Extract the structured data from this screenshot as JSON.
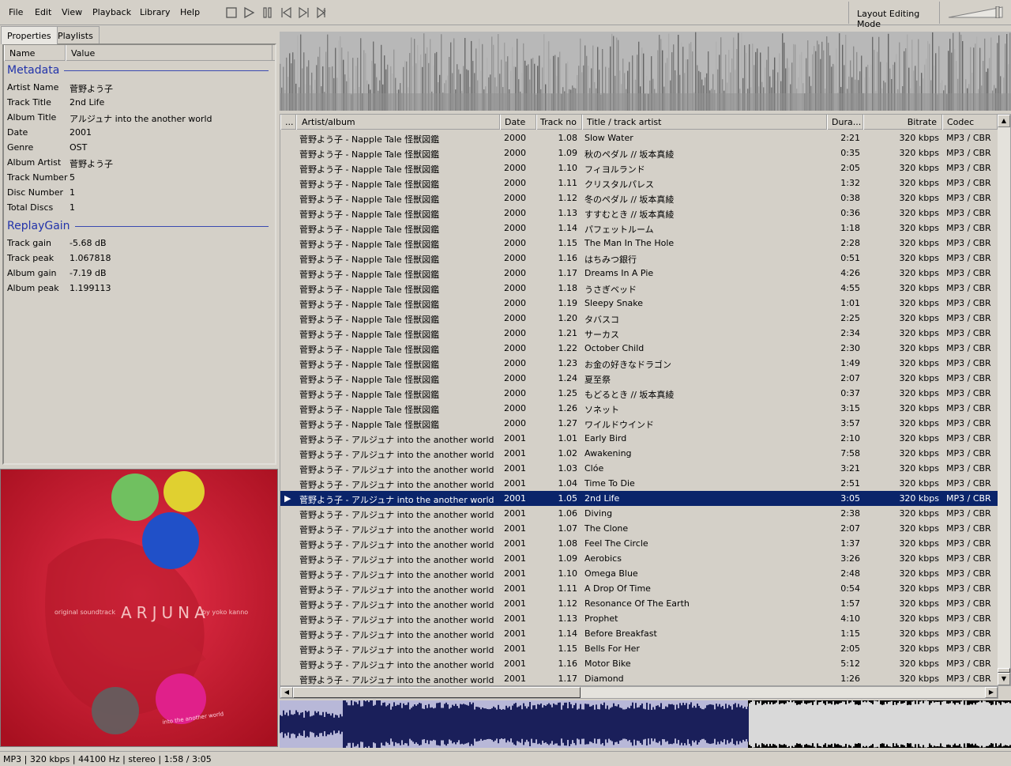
{
  "menu": {
    "file": "File",
    "edit": "Edit",
    "view": "View",
    "playback": "Playback",
    "library": "Library",
    "help": "Help"
  },
  "toolbar": {
    "layout_mode": "Layout Editing Mode",
    "volume_level": 0.92
  },
  "tabs": {
    "properties": "Properties",
    "playlists": "Playlists"
  },
  "properties": {
    "col_name": "Name",
    "col_value": "Value",
    "metadata_title": "Metadata",
    "metadata": [
      {
        "name": "Artist Name",
        "value": "菅野よう子"
      },
      {
        "name": "Track Title",
        "value": "2nd Life"
      },
      {
        "name": "Album Title",
        "value": "アルジュナ into the another world"
      },
      {
        "name": "Date",
        "value": "2001"
      },
      {
        "name": "Genre",
        "value": "OST"
      },
      {
        "name": "Album Artist",
        "value": "菅野よう子"
      },
      {
        "name": "Track Number",
        "value": "5"
      },
      {
        "name": "Disc Number",
        "value": "1"
      },
      {
        "name": "Total Discs",
        "value": "1"
      }
    ],
    "replaygain_title": "ReplayGain",
    "replaygain": [
      {
        "name": "Track gain",
        "value": "-5.68 dB"
      },
      {
        "name": "Track peak",
        "value": "1.067818"
      },
      {
        "name": "Album gain",
        "value": "-7.19 dB"
      },
      {
        "name": "Album peak",
        "value": "1.199113"
      }
    ]
  },
  "cover": {
    "left": "original soundtrack",
    "title": "ARJUNA",
    "right": "by yoko kanno",
    "sub": "into the another world",
    "bg": "#d42030"
  },
  "playlist": {
    "headers": {
      "stat": "...",
      "artist": "Artist/album",
      "date": "Date",
      "track": "Track no",
      "title": "Title / track artist",
      "duration": "Dura...",
      "bitrate": "Bitrate",
      "codec": "Codec"
    },
    "selected_color": "#0a246a",
    "now_playing_glyph": "▶",
    "rows": [
      {
        "artist": "菅野よう子 - Napple Tale 怪獣図鑑",
        "date": "2000",
        "track": "1.08",
        "title": "Slow Water",
        "duration": "2:21",
        "bitrate": "320 kbps",
        "codec": "MP3 / CBR"
      },
      {
        "artist": "菅野よう子 - Napple Tale 怪獣図鑑",
        "date": "2000",
        "track": "1.09",
        "title": "秋のペダル // 坂本真綾",
        "duration": "0:35",
        "bitrate": "320 kbps",
        "codec": "MP3 / CBR"
      },
      {
        "artist": "菅野よう子 - Napple Tale 怪獣図鑑",
        "date": "2000",
        "track": "1.10",
        "title": "フィヨルランド",
        "duration": "2:05",
        "bitrate": "320 kbps",
        "codec": "MP3 / CBR"
      },
      {
        "artist": "菅野よう子 - Napple Tale 怪獣図鑑",
        "date": "2000",
        "track": "1.11",
        "title": "クリスタルパレス",
        "duration": "1:32",
        "bitrate": "320 kbps",
        "codec": "MP3 / CBR"
      },
      {
        "artist": "菅野よう子 - Napple Tale 怪獣図鑑",
        "date": "2000",
        "track": "1.12",
        "title": "冬のペダル // 坂本真綾",
        "duration": "0:38",
        "bitrate": "320 kbps",
        "codec": "MP3 / CBR"
      },
      {
        "artist": "菅野よう子 - Napple Tale 怪獣図鑑",
        "date": "2000",
        "track": "1.13",
        "title": "すすむとき // 坂本真綾",
        "duration": "0:36",
        "bitrate": "320 kbps",
        "codec": "MP3 / CBR"
      },
      {
        "artist": "菅野よう子 - Napple Tale 怪獣図鑑",
        "date": "2000",
        "track": "1.14",
        "title": "パフェットルーム",
        "duration": "1:18",
        "bitrate": "320 kbps",
        "codec": "MP3 / CBR"
      },
      {
        "artist": "菅野よう子 - Napple Tale 怪獣図鑑",
        "date": "2000",
        "track": "1.15",
        "title": "The Man In The Hole",
        "duration": "2:28",
        "bitrate": "320 kbps",
        "codec": "MP3 / CBR"
      },
      {
        "artist": "菅野よう子 - Napple Tale 怪獣図鑑",
        "date": "2000",
        "track": "1.16",
        "title": "はちみつ銀行",
        "duration": "0:51",
        "bitrate": "320 kbps",
        "codec": "MP3 / CBR"
      },
      {
        "artist": "菅野よう子 - Napple Tale 怪獣図鑑",
        "date": "2000",
        "track": "1.17",
        "title": "Dreams In A Pie",
        "duration": "4:26",
        "bitrate": "320 kbps",
        "codec": "MP3 / CBR"
      },
      {
        "artist": "菅野よう子 - Napple Tale 怪獣図鑑",
        "date": "2000",
        "track": "1.18",
        "title": "うさぎベッド",
        "duration": "4:55",
        "bitrate": "320 kbps",
        "codec": "MP3 / CBR"
      },
      {
        "artist": "菅野よう子 - Napple Tale 怪獣図鑑",
        "date": "2000",
        "track": "1.19",
        "title": "Sleepy Snake",
        "duration": "1:01",
        "bitrate": "320 kbps",
        "codec": "MP3 / CBR"
      },
      {
        "artist": "菅野よう子 - Napple Tale 怪獣図鑑",
        "date": "2000",
        "track": "1.20",
        "title": "タバスコ",
        "duration": "2:25",
        "bitrate": "320 kbps",
        "codec": "MP3 / CBR"
      },
      {
        "artist": "菅野よう子 - Napple Tale 怪獣図鑑",
        "date": "2000",
        "track": "1.21",
        "title": "サーカス",
        "duration": "2:34",
        "bitrate": "320 kbps",
        "codec": "MP3 / CBR"
      },
      {
        "artist": "菅野よう子 - Napple Tale 怪獣図鑑",
        "date": "2000",
        "track": "1.22",
        "title": "October Child",
        "duration": "2:30",
        "bitrate": "320 kbps",
        "codec": "MP3 / CBR"
      },
      {
        "artist": "菅野よう子 - Napple Tale 怪獣図鑑",
        "date": "2000",
        "track": "1.23",
        "title": "お金の好きなドラゴン",
        "duration": "1:49",
        "bitrate": "320 kbps",
        "codec": "MP3 / CBR"
      },
      {
        "artist": "菅野よう子 - Napple Tale 怪獣図鑑",
        "date": "2000",
        "track": "1.24",
        "title": "夏至祭",
        "duration": "2:07",
        "bitrate": "320 kbps",
        "codec": "MP3 / CBR"
      },
      {
        "artist": "菅野よう子 - Napple Tale 怪獣図鑑",
        "date": "2000",
        "track": "1.25",
        "title": "もどるとき // 坂本真綾",
        "duration": "0:37",
        "bitrate": "320 kbps",
        "codec": "MP3 / CBR"
      },
      {
        "artist": "菅野よう子 - Napple Tale 怪獣図鑑",
        "date": "2000",
        "track": "1.26",
        "title": "ソネット",
        "duration": "3:15",
        "bitrate": "320 kbps",
        "codec": "MP3 / CBR"
      },
      {
        "artist": "菅野よう子 - Napple Tale 怪獣図鑑",
        "date": "2000",
        "track": "1.27",
        "title": "ワイルドウインド",
        "duration": "3:57",
        "bitrate": "320 kbps",
        "codec": "MP3 / CBR"
      },
      {
        "artist": "菅野よう子 - アルジュナ into the another world",
        "date": "2001",
        "track": "1.01",
        "title": "Early Bird",
        "duration": "2:10",
        "bitrate": "320 kbps",
        "codec": "MP3 / CBR"
      },
      {
        "artist": "菅野よう子 - アルジュナ into the another world",
        "date": "2001",
        "track": "1.02",
        "title": "Awakening",
        "duration": "7:58",
        "bitrate": "320 kbps",
        "codec": "MP3 / CBR"
      },
      {
        "artist": "菅野よう子 - アルジュナ into the another world",
        "date": "2001",
        "track": "1.03",
        "title": "Clóe",
        "duration": "3:21",
        "bitrate": "320 kbps",
        "codec": "MP3 / CBR"
      },
      {
        "artist": "菅野よう子 - アルジュナ into the another world",
        "date": "2001",
        "track": "1.04",
        "title": "Time To Die",
        "duration": "2:51",
        "bitrate": "320 kbps",
        "codec": "MP3 / CBR"
      },
      {
        "artist": "菅野よう子 - アルジュナ into the another world",
        "date": "2001",
        "track": "1.05",
        "title": "2nd Life",
        "duration": "3:05",
        "bitrate": "320 kbps",
        "codec": "MP3 / CBR",
        "selected": true
      },
      {
        "artist": "菅野よう子 - アルジュナ into the another world",
        "date": "2001",
        "track": "1.06",
        "title": "Diving",
        "duration": "2:38",
        "bitrate": "320 kbps",
        "codec": "MP3 / CBR"
      },
      {
        "artist": "菅野よう子 - アルジュナ into the another world",
        "date": "2001",
        "track": "1.07",
        "title": "The Clone",
        "duration": "2:07",
        "bitrate": "320 kbps",
        "codec": "MP3 / CBR"
      },
      {
        "artist": "菅野よう子 - アルジュナ into the another world",
        "date": "2001",
        "track": "1.08",
        "title": "Feel The Circle",
        "duration": "1:37",
        "bitrate": "320 kbps",
        "codec": "MP3 / CBR"
      },
      {
        "artist": "菅野よう子 - アルジュナ into the another world",
        "date": "2001",
        "track": "1.09",
        "title": "Aerobics",
        "duration": "3:26",
        "bitrate": "320 kbps",
        "codec": "MP3 / CBR"
      },
      {
        "artist": "菅野よう子 - アルジュナ into the another world",
        "date": "2001",
        "track": "1.10",
        "title": "Omega Blue",
        "duration": "2:48",
        "bitrate": "320 kbps",
        "codec": "MP3 / CBR"
      },
      {
        "artist": "菅野よう子 - アルジュナ into the another world",
        "date": "2001",
        "track": "1.11",
        "title": "A Drop Of Time",
        "duration": "0:54",
        "bitrate": "320 kbps",
        "codec": "MP3 / CBR"
      },
      {
        "artist": "菅野よう子 - アルジュナ into the another world",
        "date": "2001",
        "track": "1.12",
        "title": "Resonance Of The Earth",
        "duration": "1:57",
        "bitrate": "320 kbps",
        "codec": "MP3 / CBR"
      },
      {
        "artist": "菅野よう子 - アルジュナ into the another world",
        "date": "2001",
        "track": "1.13",
        "title": "Prophet",
        "duration": "4:10",
        "bitrate": "320 kbps",
        "codec": "MP3 / CBR"
      },
      {
        "artist": "菅野よう子 - アルジュナ into the another world",
        "date": "2001",
        "track": "1.14",
        "title": "Before Breakfast",
        "duration": "1:15",
        "bitrate": "320 kbps",
        "codec": "MP3 / CBR"
      },
      {
        "artist": "菅野よう子 - アルジュナ into the another world",
        "date": "2001",
        "track": "1.15",
        "title": "Bells For Her",
        "duration": "2:05",
        "bitrate": "320 kbps",
        "codec": "MP3 / CBR"
      },
      {
        "artist": "菅野よう子 - アルジュナ into the another world",
        "date": "2001",
        "track": "1.16",
        "title": "Motor Bike",
        "duration": "5:12",
        "bitrate": "320 kbps",
        "codec": "MP3 / CBR"
      },
      {
        "artist": "菅野よう子 - アルジュナ into the another world",
        "date": "2001",
        "track": "1.17",
        "title": "Diamond",
        "duration": "1:26",
        "bitrate": "320 kbps",
        "codec": "MP3 / CBR"
      }
    ]
  },
  "seekbar": {
    "played_fraction": 0.64,
    "played_color": "#1a1f5a",
    "bg_color": "#b8b8d8"
  },
  "status": "MP3 | 320 kbps | 44100 Hz | stereo | 1:58 / 3:05"
}
